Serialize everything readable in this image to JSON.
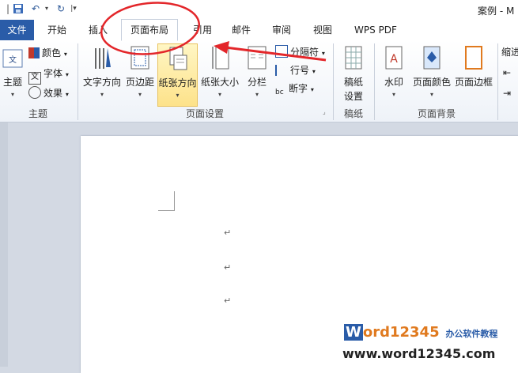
{
  "window": {
    "title": "案例 - M"
  },
  "quick_access": [
    "save-icon",
    "undo-icon",
    "redo-icon"
  ],
  "tabs": [
    {
      "label": "文件"
    },
    {
      "label": "开始"
    },
    {
      "label": "插入"
    },
    {
      "label": "页面布局"
    },
    {
      "label": "引用"
    },
    {
      "label": "邮件"
    },
    {
      "label": "审阅"
    },
    {
      "label": "视图"
    },
    {
      "label": "WPS PDF"
    }
  ],
  "groups": {
    "theme": {
      "label": "主题",
      "big": "主题",
      "items": [
        "颜色",
        "字体",
        "效果"
      ]
    },
    "page_setup": {
      "label": "页面设置",
      "buttons": [
        "文字方向",
        "页边距",
        "纸张方向",
        "纸张大小",
        "分栏"
      ],
      "small": [
        "分隔符",
        "行号",
        "断字"
      ]
    },
    "draft": {
      "label": "稿纸",
      "button_line1": "稿纸",
      "button_line2": "设置"
    },
    "background": {
      "label": "页面背景",
      "buttons": [
        "水印",
        "页面颜色",
        "页面边框"
      ]
    },
    "paragraph": {
      "items": [
        "缩进"
      ]
    }
  },
  "document": {
    "paragraph_marks": [
      "↵",
      "↵",
      "↵"
    ]
  },
  "watermark": {
    "brand_w": "W",
    "brand_rest": "ord12345",
    "tagline": "办公软件教程",
    "url": "www.word12345.com"
  },
  "colors": {
    "file_tab": "#2a5ca8",
    "annotation": "#e3262a",
    "selected": "#fde28a"
  }
}
